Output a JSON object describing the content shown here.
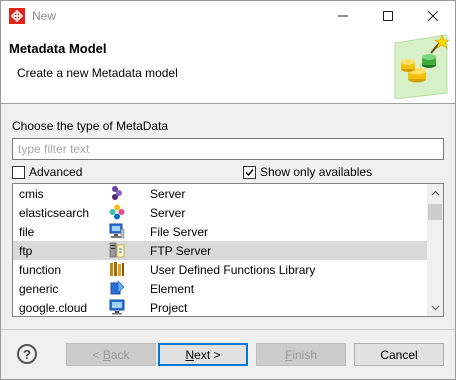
{
  "window": {
    "title": "New"
  },
  "header": {
    "title": "Metadata Model",
    "description": "Create a new Metadata model"
  },
  "body": {
    "choose_label": "Choose the type of MetaData",
    "filter_placeholder": "type filter text",
    "advanced_label": "Advanced",
    "advanced_checked": false,
    "show_available_label": "Show only availables",
    "show_available_checked": true
  },
  "list": {
    "items": [
      {
        "name": "cmis",
        "icon": "cmis-server-icon",
        "description": "Server",
        "selected": false
      },
      {
        "name": "elasticsearch",
        "icon": "elasticsearch-server-icon",
        "description": "Server",
        "selected": false
      },
      {
        "name": "file",
        "icon": "file-server-icon",
        "description": "File Server",
        "selected": false
      },
      {
        "name": "ftp",
        "icon": "ftp-server-icon",
        "description": "FTP Server",
        "selected": true
      },
      {
        "name": "function",
        "icon": "function-library-icon",
        "description": "User Defined Functions Library",
        "selected": false
      },
      {
        "name": "generic",
        "icon": "generic-element-icon",
        "description": "Element",
        "selected": false
      },
      {
        "name": "google.cloud",
        "icon": "google-cloud-project-icon",
        "description": "Project",
        "selected": false
      }
    ]
  },
  "buttons": {
    "help": "?",
    "back_prefix": "< ",
    "back_mnemonic": "B",
    "back_rest": "ack",
    "next_mnemonic": "N",
    "next_rest": "ext >",
    "finish_mnemonic": "F",
    "finish_rest": "inish",
    "cancel": "Cancel"
  },
  "colors": {
    "accent": "#0078d7",
    "selection": "#d9d9d9",
    "header_bg": "#ffffff",
    "dialog_bg": "#f0f0f0"
  }
}
